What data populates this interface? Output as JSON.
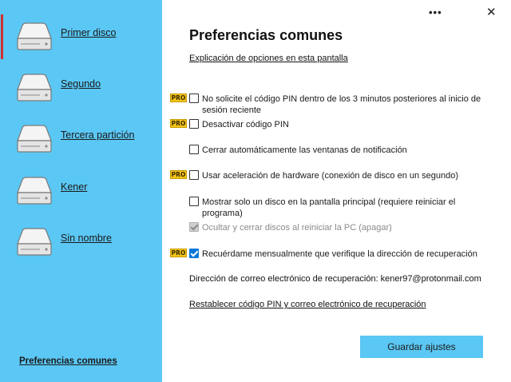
{
  "sidebar": {
    "disks": [
      {
        "label": "Primer disco",
        "active": true
      },
      {
        "label": "Segundo",
        "active": false
      },
      {
        "label": "Tercera partición",
        "active": false
      },
      {
        "label": "Kener",
        "active": false
      },
      {
        "label": "Sin nombre",
        "active": false
      }
    ],
    "footer_label": "Preferencias comunes",
    "background_color": "#5bc7f4",
    "active_marker_color": "#d0312d"
  },
  "window": {
    "more_icon": "more-icon",
    "close_icon": "close-icon"
  },
  "main": {
    "title": "Preferencias comunes",
    "explain_link": "Explicación de opciones en esta pantalla",
    "pro_badge": "PRO",
    "options": [
      {
        "label": "No solicite el código PIN dentro de los 3 minutos posteriores al inicio de sesión reciente",
        "checked": false,
        "pro": true,
        "disabled": false
      },
      {
        "label": "Desactivar código PIN",
        "checked": false,
        "pro": true,
        "disabled": false
      },
      {
        "label": "Cerrar automáticamente las ventanas de notificación",
        "checked": false,
        "pro": false,
        "disabled": false
      },
      {
        "label": "Usar aceleración de hardware (conexión de disco en un segundo)",
        "checked": false,
        "pro": true,
        "disabled": false
      },
      {
        "label": "Mostrar solo un disco en la pantalla principal (requiere reiniciar el programa)",
        "checked": false,
        "pro": false,
        "disabled": false
      },
      {
        "label": "Ocultar y cerrar discos al reiniciar la PC (apagar)",
        "checked": true,
        "pro": false,
        "disabled": true
      },
      {
        "label": "Recuérdame mensualmente que verifique la dirección de recuperación",
        "checked": true,
        "pro": true,
        "disabled": false
      }
    ],
    "recovery_text": "Dirección de correo electrónico de recuperación: kener97@protonmail.com",
    "reset_link": "Restablecer código PIN y correo electrónico de recuperación",
    "save_button": "Guardar ajustes",
    "accent_color": "#0b78d7",
    "pro_color": "#f5c518"
  }
}
